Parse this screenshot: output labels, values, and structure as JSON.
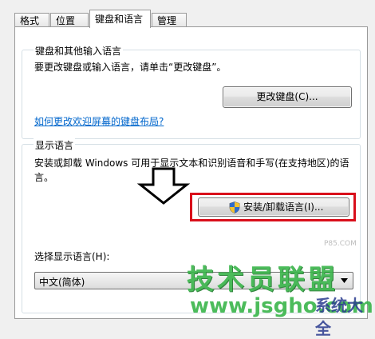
{
  "tabs": [
    "格式",
    "位置",
    "键盘和语言",
    "管理"
  ],
  "keyboard_group": {
    "title": "键盘和其他输入语言",
    "description": "要更改键盘或输入语言，请单击“更改键盘”。",
    "change_keyboard_button": "更改键盘(C)...",
    "welcome_link": "如何更改欢迎屏幕的键盘布局?"
  },
  "display_group": {
    "title": "显示语言",
    "description_line1": "安装或卸载 Windows 可用于显示文本和识别语音和手写(在支持地区)的语",
    "description_line2": "言。",
    "install_button": "安装/卸载语言(I)...",
    "select_label": "选择显示语言(H):",
    "selected_language": "中文(简体)"
  },
  "watermark": {
    "title": "技术员联盟",
    "url": "www.jsgho.com",
    "corner": "系统大全",
    "corner_small": "P85.COM"
  },
  "colors": {
    "highlight": "#d90f1b",
    "link": "#0066cc",
    "watermark_green": "#39b54a"
  }
}
